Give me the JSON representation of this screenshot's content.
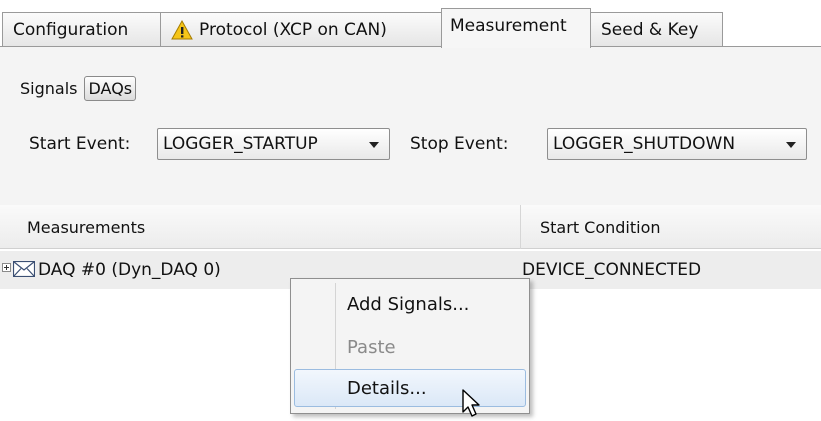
{
  "tabs": [
    {
      "label": "Configuration",
      "active": false
    },
    {
      "label": "Protocol (XCP on CAN)",
      "active": false,
      "icon": "warning-icon"
    },
    {
      "label": "Measurement",
      "active": true
    },
    {
      "label": "Seed & Key",
      "active": false
    }
  ],
  "subtabs": [
    {
      "label": "Signals",
      "selected": false
    },
    {
      "label": "DAQs",
      "selected": true
    }
  ],
  "events": {
    "start_label": "Start Event:",
    "start_value": "LOGGER_STARTUP",
    "stop_label": "Stop Event:",
    "stop_value": "LOGGER_SHUTDOWN"
  },
  "table": {
    "columns": [
      "Measurements",
      "Start Condition"
    ],
    "rows": [
      {
        "name": "DAQ #0 (Dyn_DAQ 0)",
        "start_condition": "DEVICE_CONNECTED",
        "icon": "envelope-icon"
      }
    ]
  },
  "context_menu": {
    "items": [
      {
        "label": "Add Signals...",
        "enabled": true
      },
      {
        "label": "Paste",
        "enabled": false
      },
      {
        "label": "Details...",
        "enabled": true,
        "hovered": true
      }
    ]
  },
  "colors": {
    "warning": "#f5c518",
    "menu_highlight": "#dbe8f7"
  }
}
